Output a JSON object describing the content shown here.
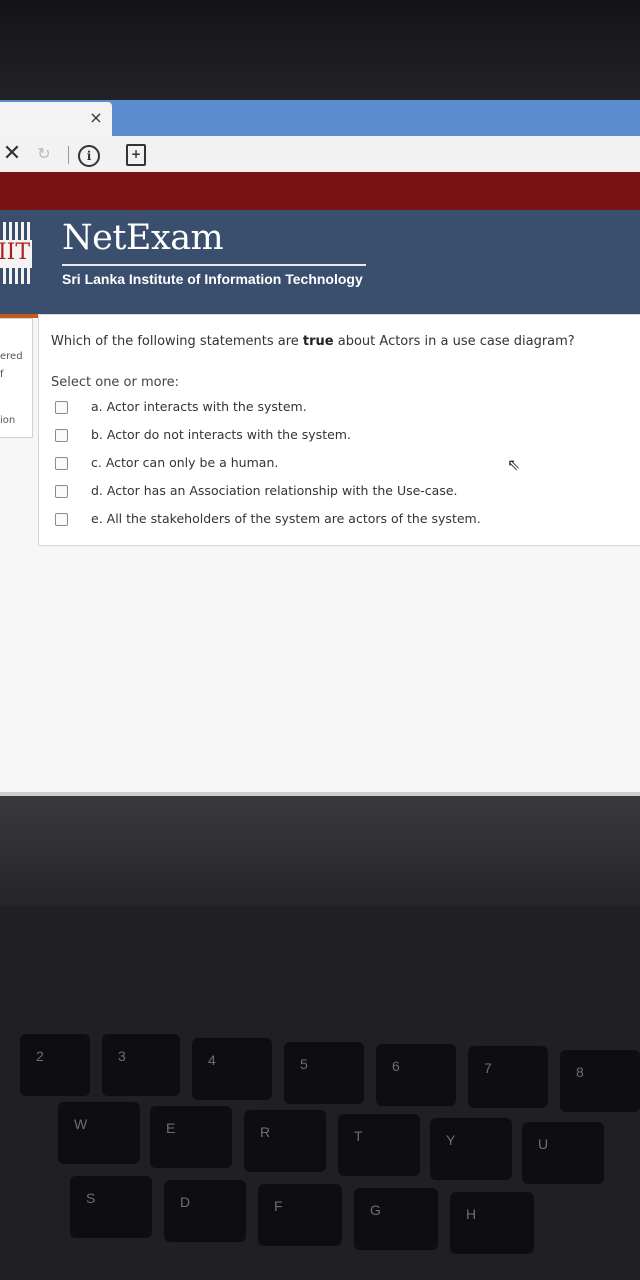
{
  "browser": {
    "tab_close": "×",
    "icons": {
      "stop": "close-icon",
      "reload": "reload-icon",
      "info": "info-icon",
      "page": "page-icon"
    }
  },
  "header": {
    "logo_text": "IIT",
    "brand": "NetExam",
    "subtitle": "Sri Lanka Institute of Information Technology"
  },
  "sidebar": {
    "frag_1": "ered",
    "frag_2": "f",
    "frag_3": "ion"
  },
  "question": {
    "text_before": "Which of the following statements are ",
    "text_bold": "true",
    "text_after": " about Actors in a use case diagram?",
    "prompt": "Select one or more:",
    "options": [
      {
        "label": "a. Actor interacts with the system.",
        "checked": false
      },
      {
        "label": "b. Actor do not interacts with the system.",
        "checked": false
      },
      {
        "label": "c. Actor can only be a human.",
        "checked": false
      },
      {
        "label": "d. Actor has an Association relationship with the Use-case.",
        "checked": false
      },
      {
        "label": "e. All the stakeholders of the system are actors of the system.",
        "checked": false
      }
    ]
  },
  "keyboard": {
    "row1": [
      "2",
      "3",
      "4",
      "5",
      "6",
      "7",
      "8"
    ],
    "row2": [
      "W",
      "E",
      "R",
      "T",
      "Y",
      "U"
    ],
    "row3": [
      "S",
      "D",
      "F",
      "G",
      "H"
    ]
  }
}
